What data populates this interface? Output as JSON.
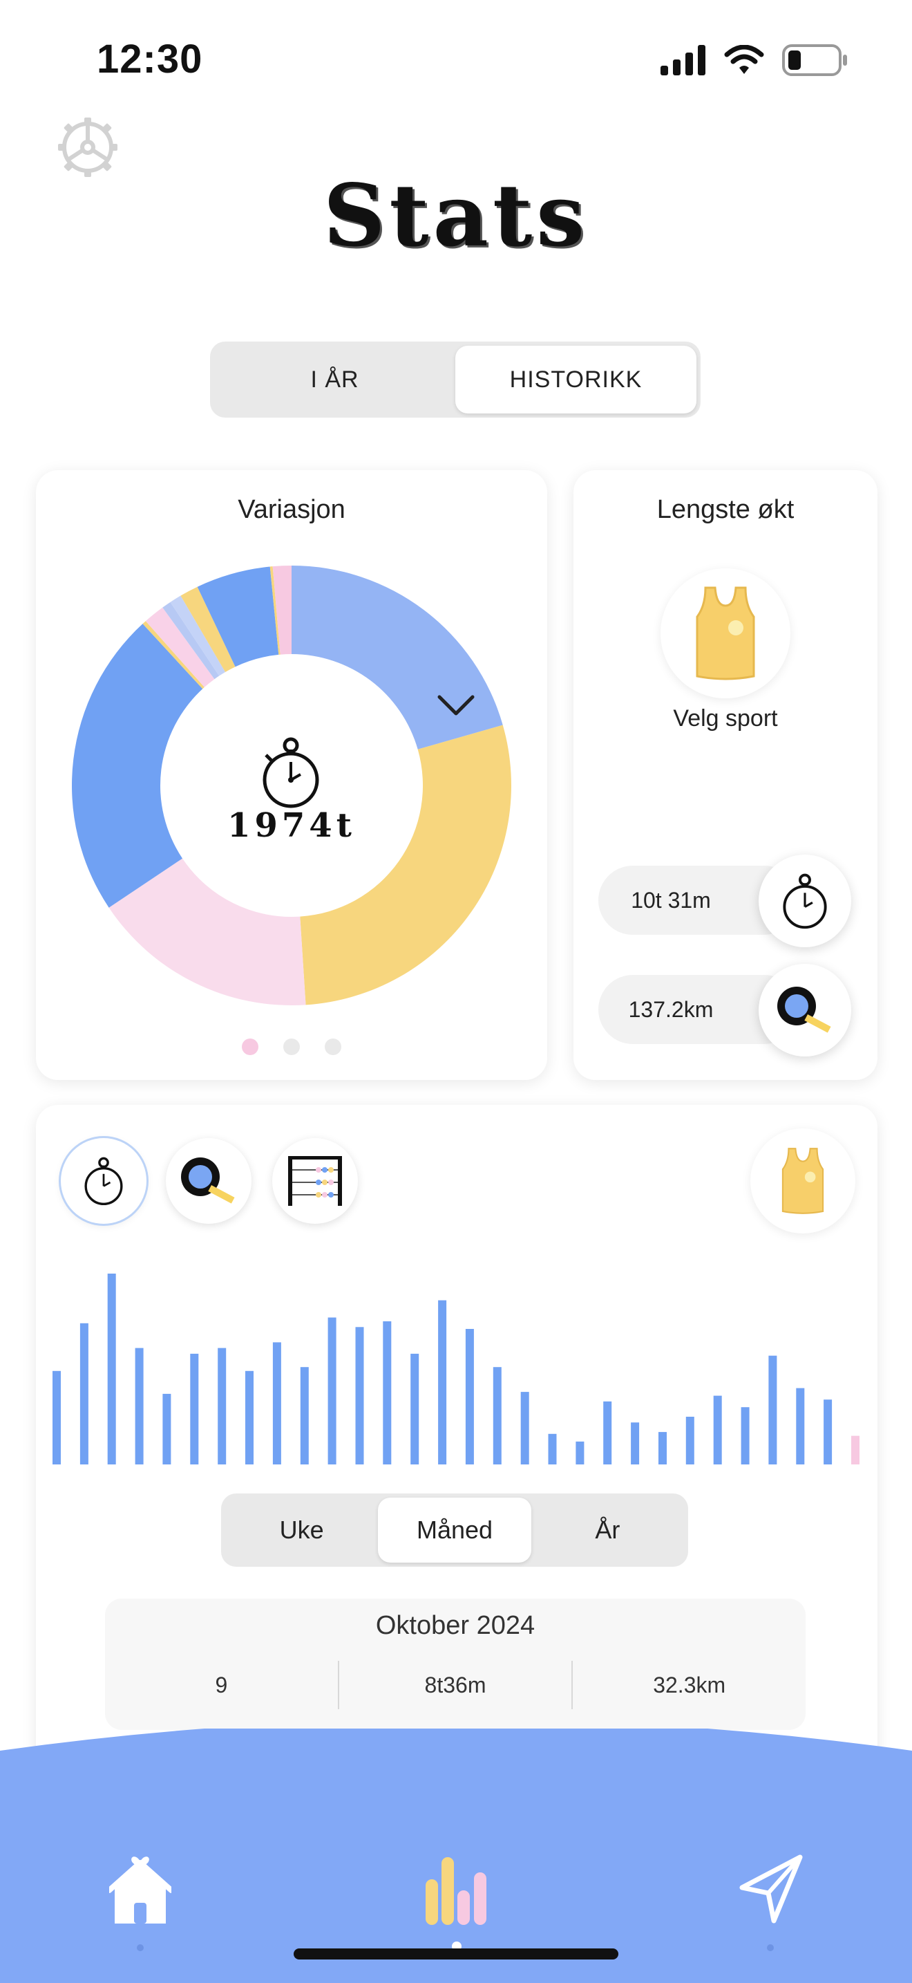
{
  "status_bar": {
    "time": "12:30"
  },
  "header": {
    "title": "Stats"
  },
  "tabs": {
    "items": [
      "I ÅR",
      "HISTORIKK"
    ],
    "active_index": 1
  },
  "variation_card": {
    "title": "Variasjon",
    "total_label": "1974t",
    "page_count": 3,
    "active_page": 0
  },
  "chart_data": [
    {
      "type": "pie",
      "title": "Variasjon",
      "center_label": "1974t",
      "values": [
        21.0,
        29.0,
        17.0,
        23.0,
        0.3,
        1.6,
        0.7,
        0.9,
        1.4,
        5.6,
        0.2,
        1.4
      ],
      "colors": [
        "#94b4f4",
        "#f7d67e",
        "#f9dcec",
        "#70a1f3",
        "#f7d67e",
        "#f9d2e8",
        "#b7c9f4",
        "#c4d3f7",
        "#f7d67e",
        "#70a1f3",
        "#f7d67e",
        "#f7c9e1"
      ]
    },
    {
      "type": "bar",
      "values": [
        49,
        74,
        100,
        61,
        37,
        58,
        61,
        49,
        64,
        51,
        77,
        72,
        75,
        58,
        86,
        71,
        51,
        38,
        16,
        12,
        33,
        22,
        17,
        25,
        36,
        30,
        57,
        40,
        34,
        15
      ],
      "ylim": [
        0,
        100
      ],
      "bar_color": "#70a1f3",
      "highlight_color": "#f7c9e1",
      "highlight_index": 29
    }
  ],
  "longest_card": {
    "title": "Lengste økt",
    "sport_label": "Velg sport",
    "duration": "10t 31m",
    "distance": "137.2km"
  },
  "period_tabs": {
    "items": [
      "Uke",
      "Måned",
      "År"
    ],
    "active_index": 1
  },
  "month_summary": {
    "title": "Oktober 2024",
    "count": "9",
    "duration": "8t36m",
    "distance": "32.3km"
  },
  "colors": {
    "accent_blue": "#70a1f3",
    "nav_blue": "#82a8f6",
    "yellow": "#f7d67e",
    "pink": "#f7c9e1"
  },
  "icons": {
    "settings": "gear-icon",
    "timer": "stopwatch-icon",
    "distance": "tape-measure-icon",
    "count": "abacus-icon",
    "sport": "tank-top-icon",
    "home": "house-icon",
    "stats": "bar-chart-icon",
    "send": "paper-plane-icon",
    "expand": "chevron-down-icon"
  }
}
